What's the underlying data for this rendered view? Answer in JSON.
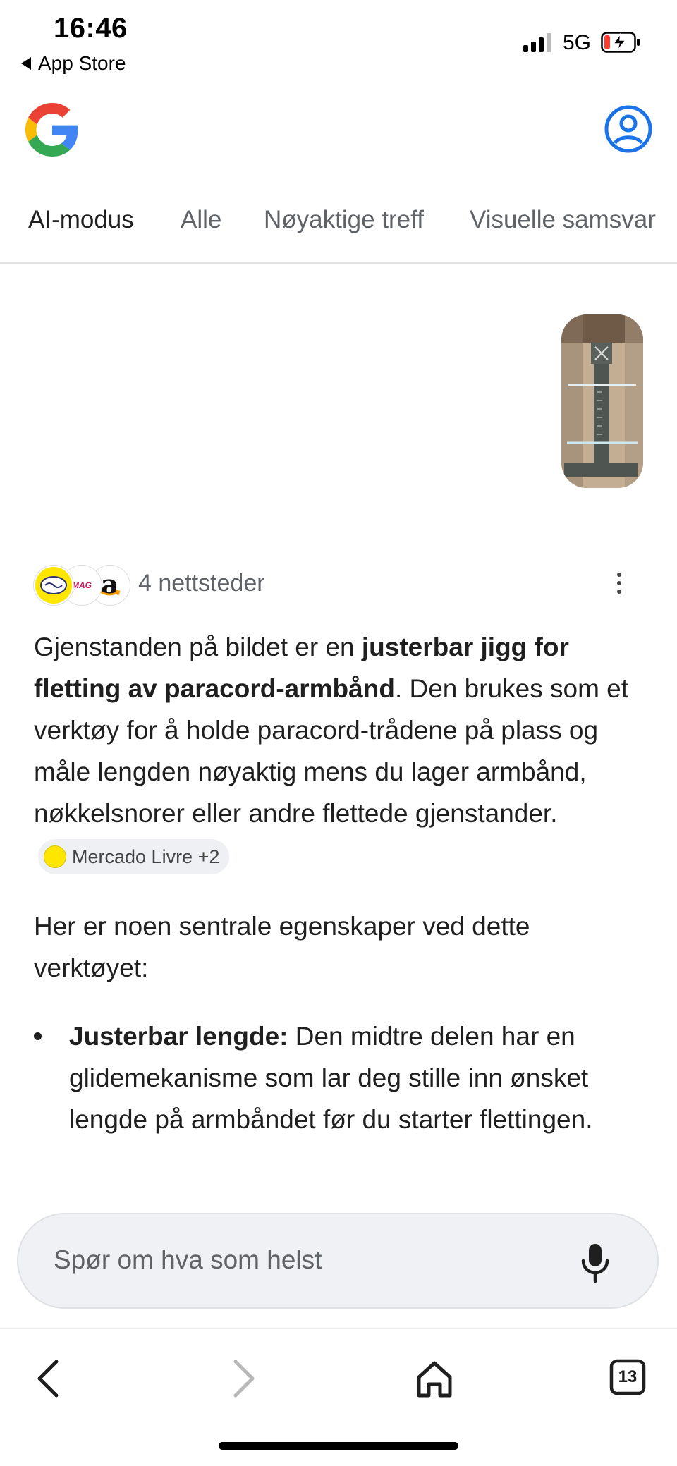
{
  "status_bar": {
    "time": "16:46",
    "back_label": "App Store",
    "network": "5G",
    "battery_state": "charging-low"
  },
  "header": {
    "logo_icon": "google-g-logo",
    "account_icon": "account-circle-icon"
  },
  "tabs": [
    {
      "label": "AI-modus",
      "active": true
    },
    {
      "label": "Alle",
      "active": false
    },
    {
      "label": "Nøyaktige treff",
      "active": false
    },
    {
      "label": "Visuelle samsvar",
      "active": false
    }
  ],
  "query_image": {
    "icon": "uploaded-photo-thumbnail"
  },
  "sources": {
    "label": "4 nettsteder",
    "favicons": [
      "mercado-livre-icon",
      "mag-icon",
      "amazon-icon"
    ],
    "fav2_text": "MAG",
    "fav3_text": "a"
  },
  "answer": {
    "p1_a": "Gjenstanden på bildet er en ",
    "p1_bold": "justerbar jigg for fletting av paracord-armbånd",
    "p1_b": ". Den brukes som et verktøy for å holde paracord-trådene på plass og måle lengden nøyaktig mens du lager armbånd, nøkkelsnorer eller andre flettede gjenstander.",
    "citation": "Mercado Livre +2",
    "p2": "Her er noen sentrale egenskaper ved dette verktøyet:",
    "bullets": [
      {
        "bold": "Justerbar lengde:",
        "text": " Den midtre delen har en glidemekanisme som lar deg stille inn ønsket lengde på armbåndet før du starter flettingen."
      }
    ]
  },
  "ask_bar": {
    "placeholder": "Spør om hva som helst",
    "mic_icon": "microphone-icon"
  },
  "bottom_nav": {
    "tab_count": "13",
    "icons": [
      "back-arrow-icon",
      "forward-arrow-icon",
      "home-icon",
      "tabs-icon"
    ]
  },
  "colors": {
    "google_blue": "#1a73e8",
    "text": "#1f1f1f",
    "muted": "#5f6368",
    "ask_bar_bg": "#eff1f4"
  }
}
